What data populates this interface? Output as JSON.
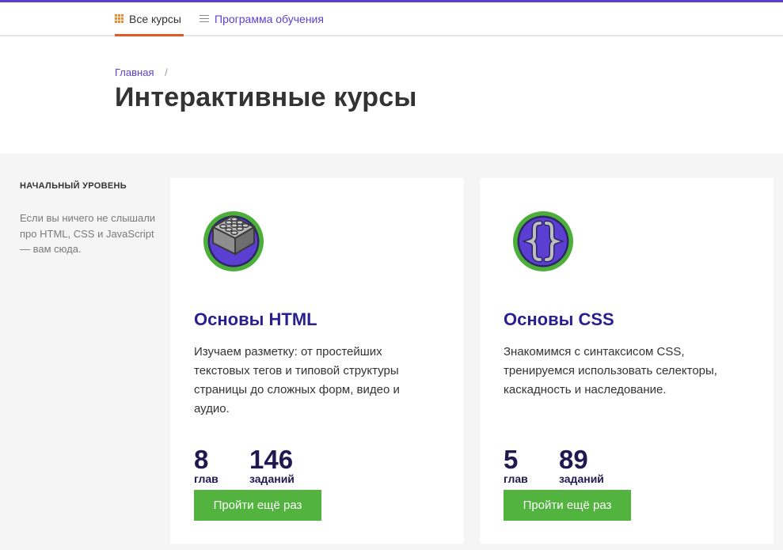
{
  "nav": {
    "all_courses": "Все курсы",
    "program": "Программа обучения"
  },
  "breadcrumb": {
    "home": "Главная",
    "separator": "/"
  },
  "page": {
    "title": "Интерактивные курсы"
  },
  "sidebar": {
    "heading": "НАЧАЛЬНЫЙ УРОВЕНЬ",
    "description": "Если вы ничего не слышали про HTML, CSS и JavaScript — вам сюда."
  },
  "courses": [
    {
      "title": "Основы HTML",
      "description": "Изучаем разметку: от простейших текстовых тегов и типовой структуры страницы до сложных форм, видео и аудио.",
      "chapters_value": "8",
      "chapters_label": "глав",
      "tasks_value": "146",
      "tasks_label": "заданий",
      "button": "Пройти ещё раз",
      "icon": "lego-brick-icon"
    },
    {
      "title": "Основы CSS",
      "description": "Знакомимся с синтаксисом CSS, тренируемся использовать селекторы, каскадность и наследование.",
      "chapters_value": "5",
      "chapters_label": "глав",
      "tasks_value": "89",
      "tasks_label": "заданий",
      "button": "Пройти ещё раз",
      "icon": "curly-braces-icon"
    }
  ],
  "colors": {
    "accent": "#5b3fd3",
    "active_underline": "#e45826",
    "button": "#52b33f",
    "title": "#2a1f8f",
    "icon_ring": "#4caf3a",
    "icon_fill": "#5b3fd3"
  }
}
